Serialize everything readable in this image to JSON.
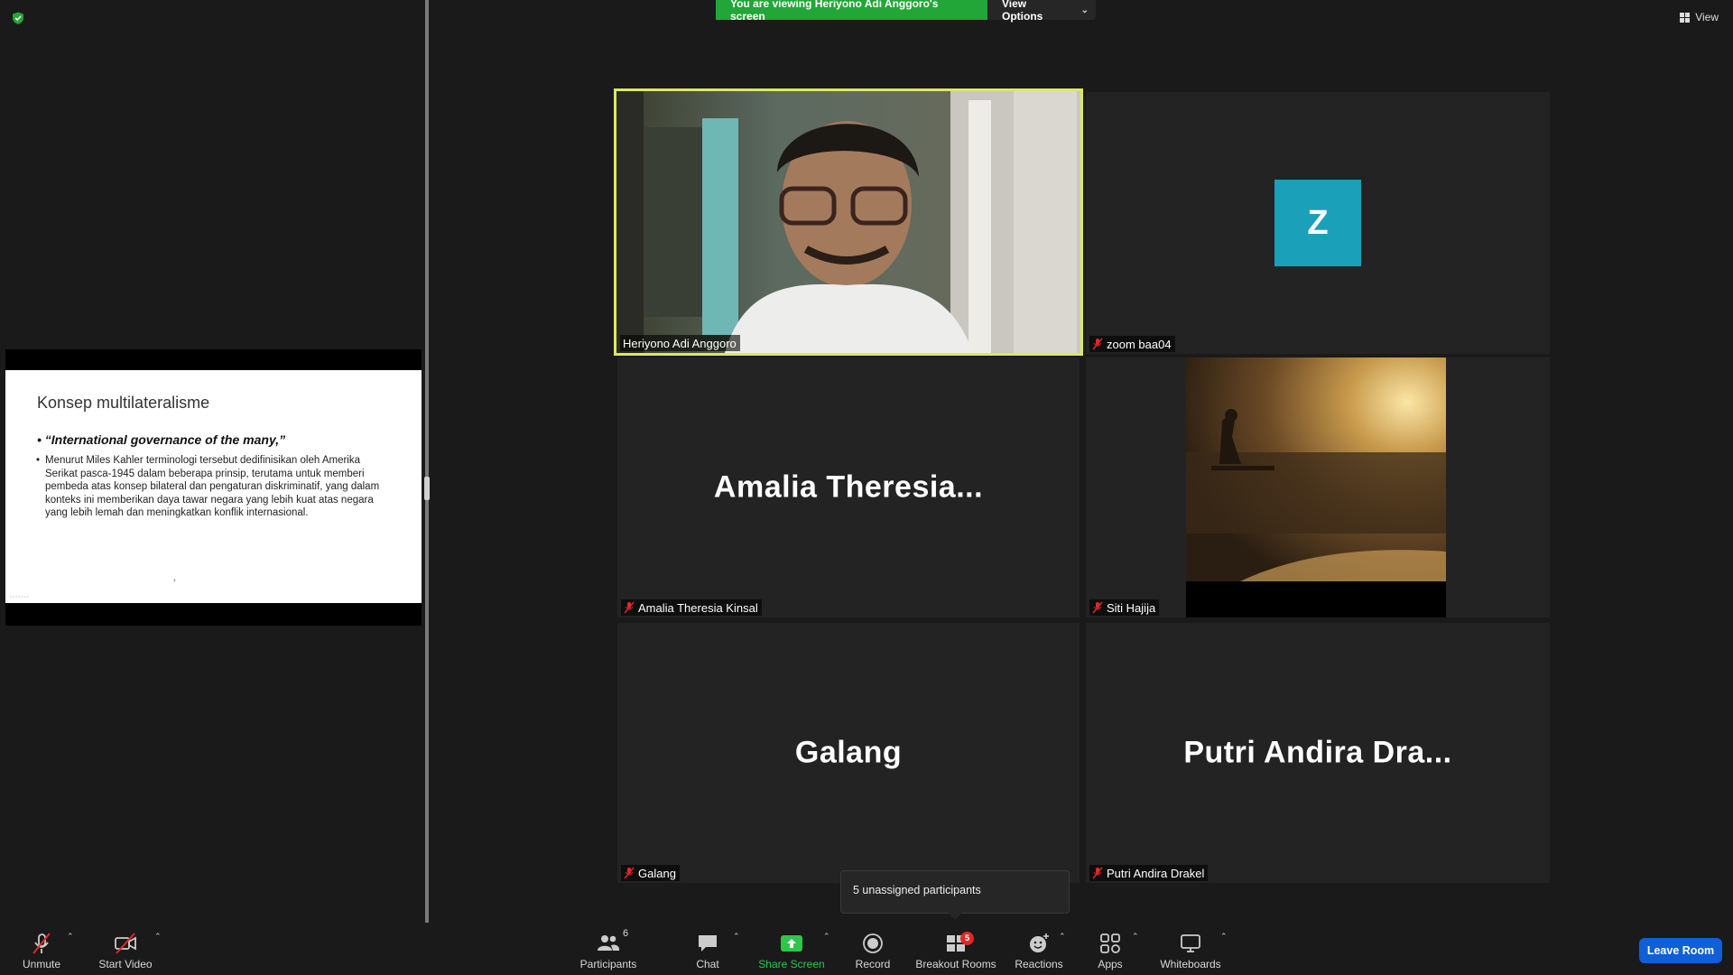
{
  "banner": {
    "viewing_text": "You are viewing Heriyono Adi Anggoro's screen",
    "view_options_label": "View Options"
  },
  "top_right": {
    "view_label": "View"
  },
  "shared_slide": {
    "title": "Konsep multilateralisme",
    "bullet1": "• “International governance of the many,”",
    "bullet2": "Menurut Miles Kahler terminologi tersebut dedifinisikan oleh Amerika Serikat pasca-1945 dalam beberapa prinsip, terutama untuk memberi pembeda atas konsep bilateral dan pengaturan diskriminatif, yang dalam konteks ini memberikan daya tawar negara yang lebih kuat atas negara yang lebih lemah dan meningkatkan konflik internasional."
  },
  "participants": [
    {
      "name": "Heriyono Adi Anggoro",
      "display": "",
      "muted": false,
      "video": true,
      "active_speaker": true
    },
    {
      "name": "zoom baa04",
      "display": "Z",
      "muted": true,
      "video": false,
      "avatar_color": "#1aa0b8"
    },
    {
      "name": "Amalia Theresia Kinsal",
      "display": "Amalia  Theresia...",
      "muted": true,
      "video": false
    },
    {
      "name": "Siti Hajija",
      "display": "",
      "muted": true,
      "video": true
    },
    {
      "name": "Galang",
      "display": "Galang",
      "muted": true,
      "video": false
    },
    {
      "name": "Putri Andira Drakel",
      "display": "Putri  Andira Dra...",
      "muted": true,
      "video": false
    }
  ],
  "tooltip": {
    "text": "5 unassigned participants"
  },
  "toolbar": {
    "unmute": "Unmute",
    "start_video": "Start Video",
    "participants": "Participants",
    "participants_count": "6",
    "chat": "Chat",
    "share_screen": "Share Screen",
    "record": "Record",
    "breakout_rooms": "Breakout Rooms",
    "breakout_badge": "5",
    "reactions": "Reactions",
    "apps": "Apps",
    "whiteboards": "Whiteboards",
    "leave_room": "Leave Room"
  },
  "colors": {
    "banner_green": "#23a638",
    "active_speaker_border": "#dbe95d",
    "share_green": "#30c54b",
    "leave_blue": "#0e5fd8",
    "mute_red": "#e02828"
  }
}
